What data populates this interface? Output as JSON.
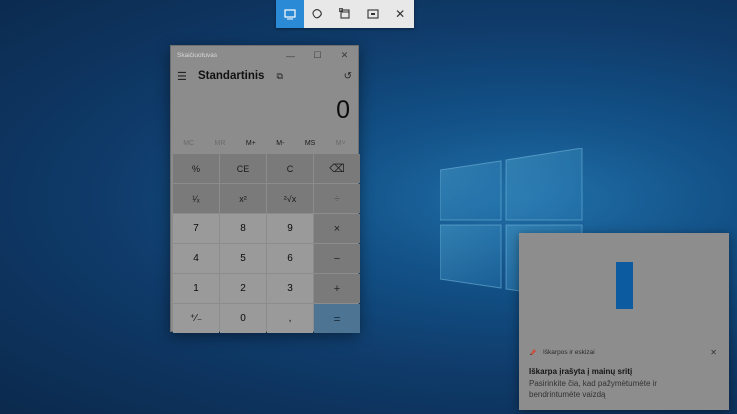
{
  "snip_toolbar": {
    "modes": [
      {
        "icon": "rectangle-snip-icon",
        "active": true
      },
      {
        "icon": "freeform-snip-icon",
        "active": false
      },
      {
        "icon": "window-snip-icon",
        "active": false
      },
      {
        "icon": "fullscreen-snip-icon",
        "active": false
      }
    ],
    "close_label": "✕"
  },
  "calculator": {
    "window_title": "Skaičiuotuvas",
    "minimize": "—",
    "maximize": "☐",
    "close": "✕",
    "hamburger": "☰",
    "mode_title": "Standartinis",
    "keep_on_top": "⧉",
    "history": "↺",
    "display_value": "0",
    "memory": [
      {
        "label": "MC",
        "enabled": false
      },
      {
        "label": "MR",
        "enabled": false
      },
      {
        "label": "M+",
        "enabled": true
      },
      {
        "label": "M-",
        "enabled": true
      },
      {
        "label": "MS",
        "enabled": true
      },
      {
        "label": "M˅",
        "enabled": false
      }
    ],
    "keys": [
      [
        "%",
        "CE",
        "C",
        "⌫"
      ],
      [
        "¹⁄ₓ",
        "x²",
        "²√x",
        "÷"
      ],
      [
        "7",
        "8",
        "9",
        "×"
      ],
      [
        "4",
        "5",
        "6",
        "−"
      ],
      [
        "1",
        "2",
        "3",
        "+"
      ],
      [
        "⁺∕₋",
        "0",
        ",",
        "="
      ]
    ]
  },
  "notification": {
    "app_name": "Iškarpos ir eskizai",
    "close": "✕",
    "title": "Iškarpa įrašyta į mainų sritį",
    "body": "Pasirinkite čia, kad pažymėtumėte ir bendrintumėte vaizdą"
  }
}
